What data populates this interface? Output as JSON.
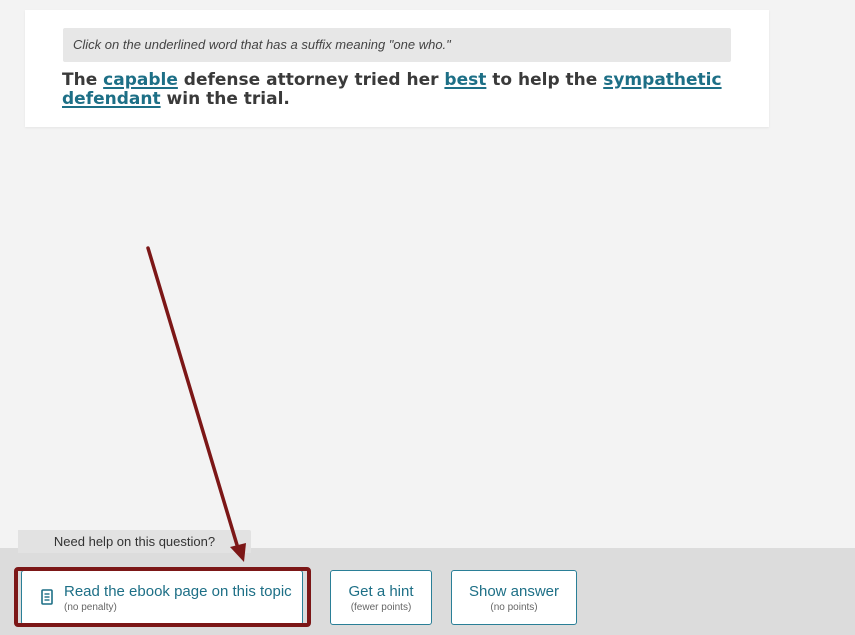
{
  "question": {
    "instruction": "Click on the underlined word that has a suffix meaning \"one who.\"",
    "sentence": {
      "w1": "The",
      "choice1": "capable",
      "w2": "defense attorney tried her",
      "choice2": "best",
      "w3": "to help the",
      "choice3": "sympathetic",
      "choice4": "defendant",
      "w4": "win the trial."
    }
  },
  "help": {
    "tab_label": "Need help on this question?",
    "ebook": {
      "label": "Read the ebook page on this topic",
      "note": "(no penalty)",
      "icon": "document-icon"
    },
    "hint": {
      "label": "Get a hint",
      "note": "(fewer points)"
    },
    "answer": {
      "label": "Show answer",
      "note": "(no points)"
    }
  },
  "colors": {
    "link": "#1d6f86",
    "annotation": "#7c1717",
    "help_bar": "#dcdcdc"
  }
}
